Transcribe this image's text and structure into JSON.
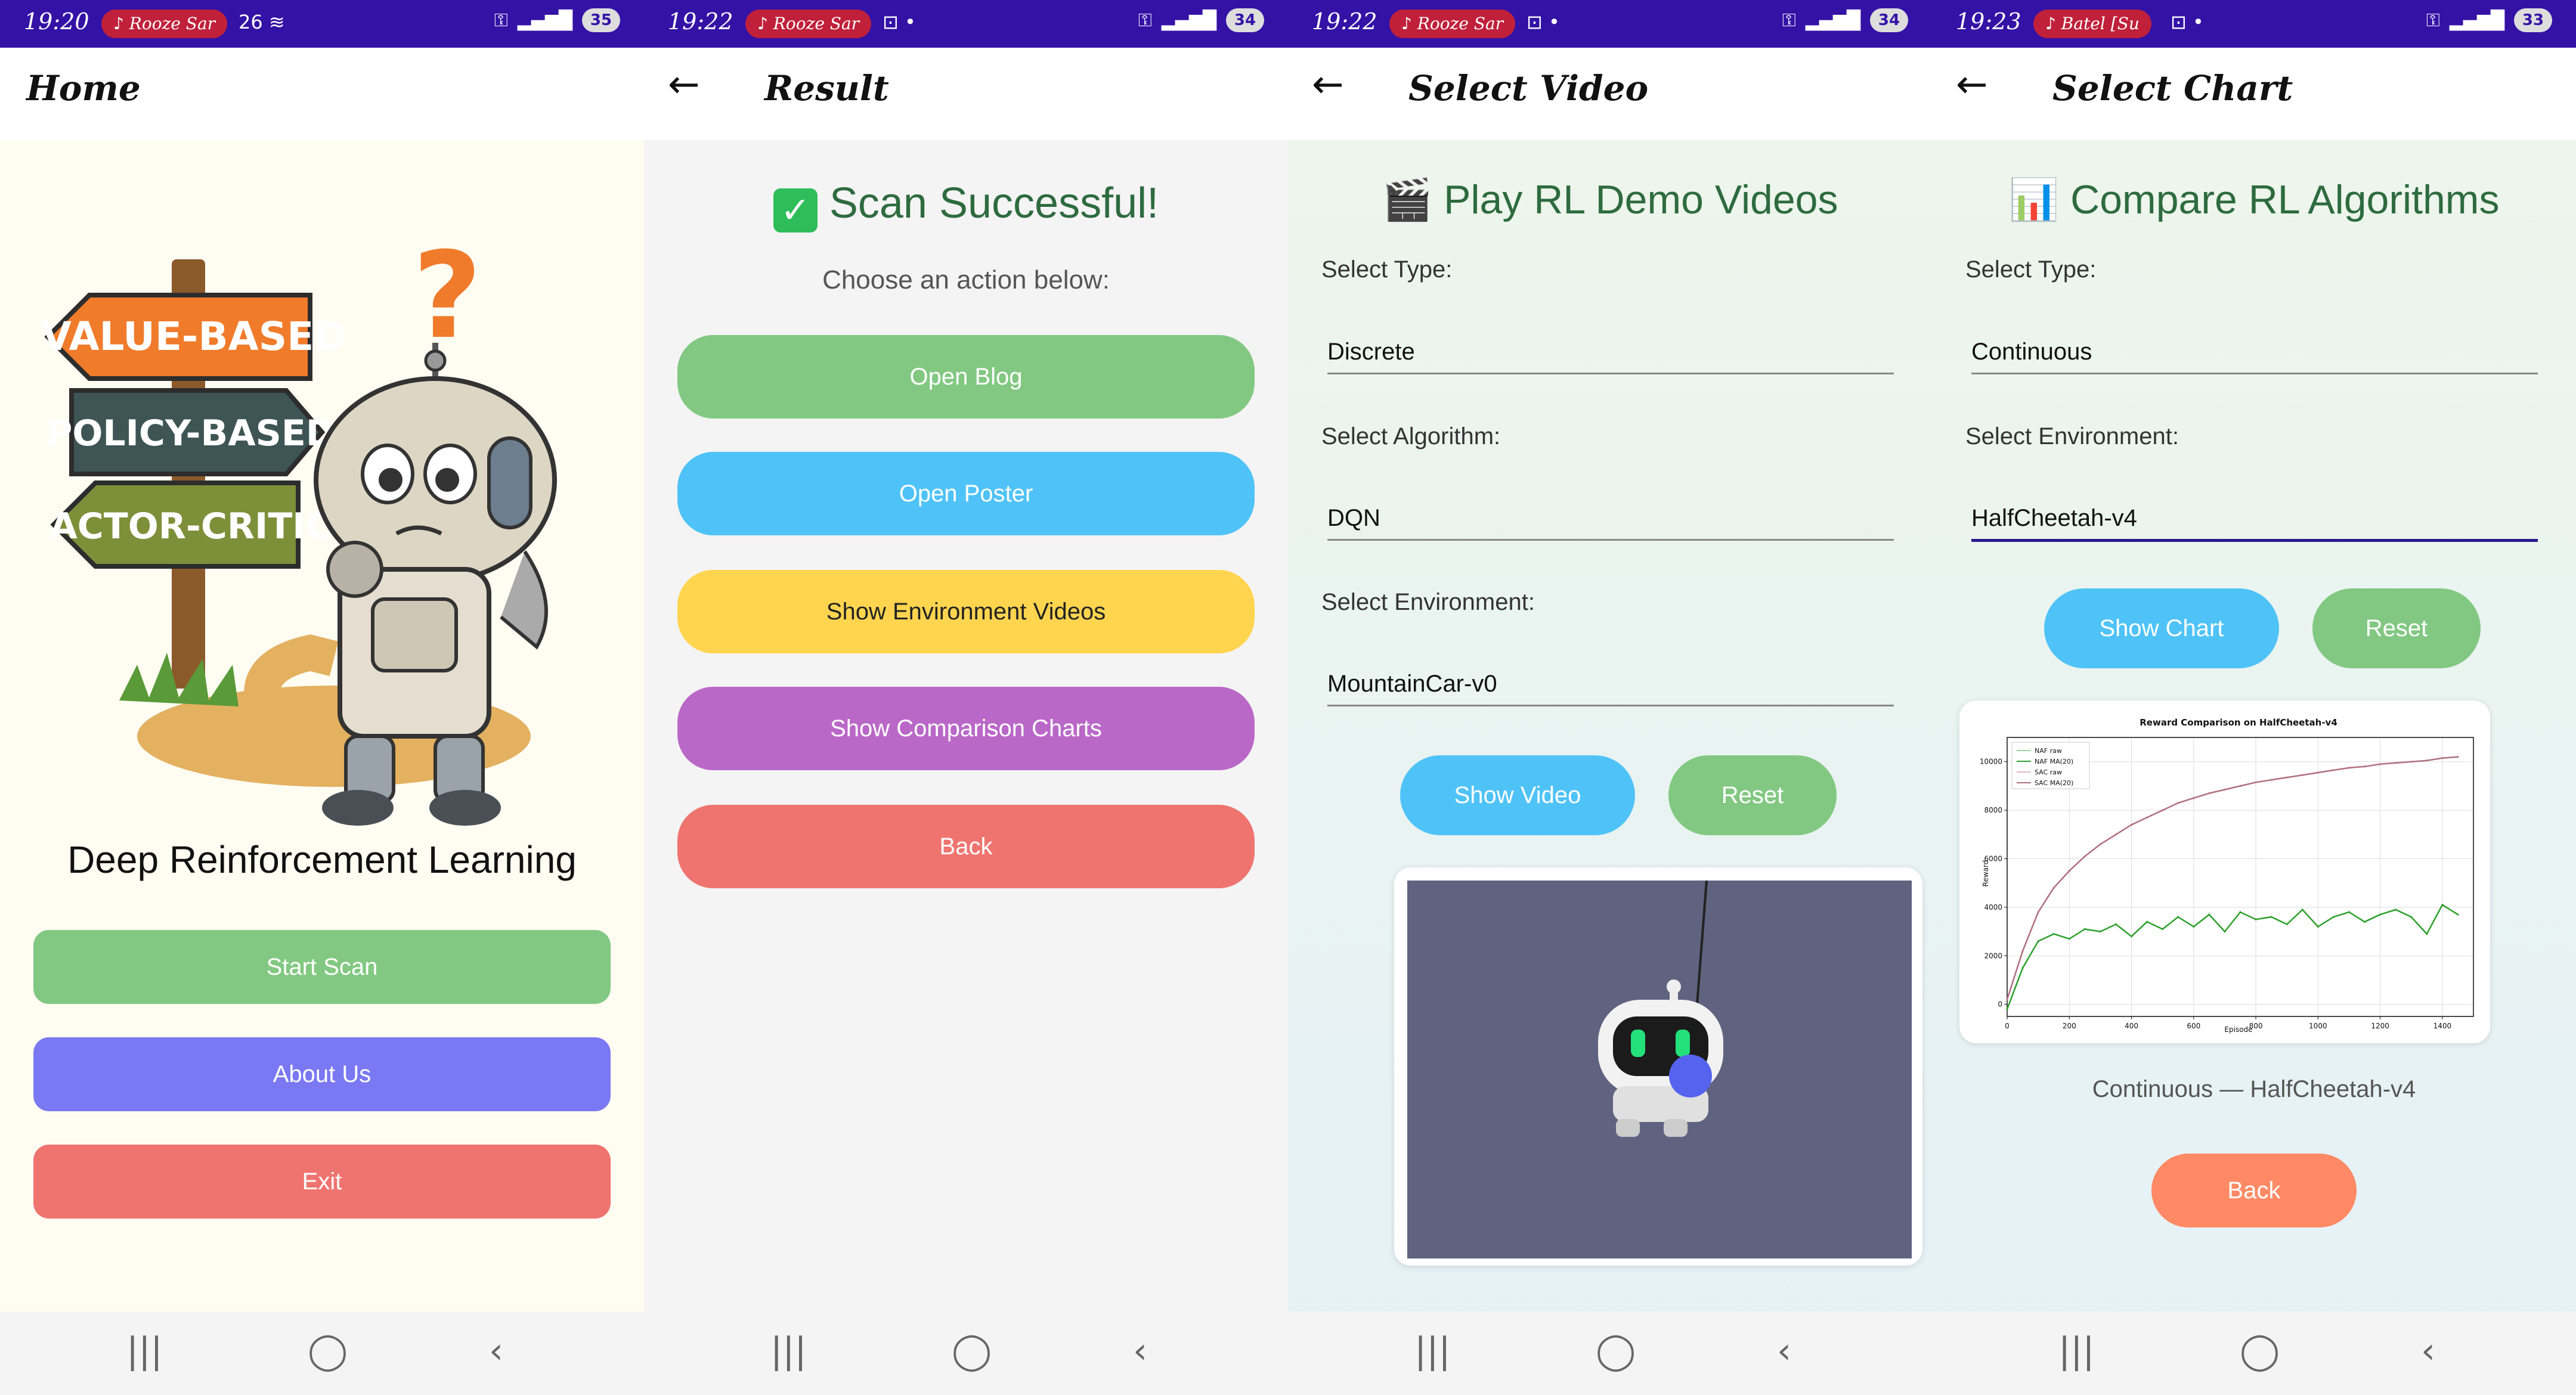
{
  "screens": [
    {
      "status": {
        "time": "19:20",
        "music": "♪ Rooze Sar",
        "extra": "26 ≋",
        "battery": "35"
      },
      "appbar": {
        "title": "Home"
      },
      "illustration": {
        "sign1": "VALUE-BASED",
        "sign2": "POLICY-BASED",
        "sign3": "ACTOR-CRITIC",
        "question": "?"
      },
      "app_title": "Deep Reinforcement Learning",
      "buttons": {
        "start": "Start Scan",
        "about": "About Us",
        "exit": "Exit"
      }
    },
    {
      "status": {
        "time": "19:22",
        "music": "♪ Rooze Sar",
        "extra": "⊡ •",
        "battery": "34"
      },
      "appbar": {
        "title": "Result"
      },
      "heading": "Scan Successful!",
      "subtitle": "Choose an action below:",
      "buttons": {
        "blog": "Open Blog",
        "poster": "Open Poster",
        "videos": "Show Environment Videos",
        "charts": "Show Comparison Charts",
        "back": "Back"
      }
    },
    {
      "status": {
        "time": "19:22",
        "music": "♪ Rooze Sar",
        "extra": "⊡ •",
        "battery": "34"
      },
      "appbar": {
        "title": "Select Video"
      },
      "heading": "Play RL Demo Videos",
      "type_label": "Select Type:",
      "type_value": "Discrete",
      "algo_label": "Select Algorithm:",
      "algo_value": "DQN",
      "env_label": "Select Environment:",
      "env_value": "MountainCar-v0",
      "show_button": "Show Video",
      "reset_button": "Reset"
    },
    {
      "status": {
        "time": "19:23",
        "music": "♪ Batel [Su",
        "extra": "⊡ •",
        "battery": "33"
      },
      "appbar": {
        "title": "Select Chart"
      },
      "heading": "Compare RL Algorithms",
      "type_label": "Select Type:",
      "type_value": "Continuous",
      "env_label": "Select Environment:",
      "env_value": "HalfCheetah-v4",
      "show_button": "Show Chart",
      "reset_button": "Reset",
      "caption": "Continuous — HalfCheetah-v4",
      "back_button": "Back"
    }
  ],
  "colors": {
    "status_bar": "#3412a6",
    "green": "#82c882",
    "blue": "#4fc3f7",
    "yellow": "#ffd54f",
    "purple": "#ba68c8",
    "red": "#ef7470",
    "indigo": "#7a78f2",
    "orange": "#ff8a65"
  },
  "chart_data": {
    "type": "line",
    "title": "Reward Comparison on HalfCheetah-v4",
    "xlabel": "Episode",
    "ylabel": "Reward",
    "xlim": [
      0,
      1500
    ],
    "ylim": [
      -500,
      11000
    ],
    "xticks": [
      0,
      200,
      400,
      600,
      800,
      1000,
      1200,
      1400
    ],
    "yticks": [
      0,
      2000,
      4000,
      6000,
      8000,
      10000
    ],
    "legend": [
      "NAF raw",
      "NAF MA(20)",
      "SAC raw",
      "SAC MA(20)"
    ],
    "legend_position": "top-left",
    "grid": true,
    "series": [
      {
        "name": "NAF MA(20)",
        "color": "#2ca02c",
        "x": [
          0,
          50,
          100,
          150,
          200,
          250,
          300,
          350,
          400,
          450,
          500,
          550,
          600,
          650,
          700,
          750,
          800,
          850,
          900,
          950,
          1000,
          1050,
          1100,
          1150,
          1200,
          1250,
          1300,
          1350,
          1400,
          1450
        ],
        "values": [
          -200,
          1500,
          2600,
          2900,
          2700,
          3100,
          3000,
          3300,
          2800,
          3400,
          3100,
          3600,
          3200,
          3700,
          3000,
          3800,
          3500,
          3600,
          3300,
          3900,
          3200,
          3600,
          3800,
          3400,
          3700,
          3900,
          3600,
          2900,
          4100,
          3700
        ]
      },
      {
        "name": "SAC MA(20)",
        "color": "#b07080",
        "x": [
          0,
          50,
          100,
          150,
          200,
          250,
          300,
          350,
          400,
          450,
          500,
          550,
          600,
          650,
          700,
          750,
          800,
          850,
          900,
          950,
          1000,
          1050,
          1100,
          1150,
          1200,
          1250,
          1300,
          1350,
          1400,
          1450
        ],
        "values": [
          200,
          2200,
          3800,
          4800,
          5500,
          6100,
          6600,
          7000,
          7400,
          7700,
          8000,
          8300,
          8500,
          8700,
          8850,
          9000,
          9150,
          9250,
          9350,
          9450,
          9550,
          9650,
          9750,
          9800,
          9900,
          9950,
          10000,
          10050,
          10150,
          10200
        ]
      }
    ]
  }
}
